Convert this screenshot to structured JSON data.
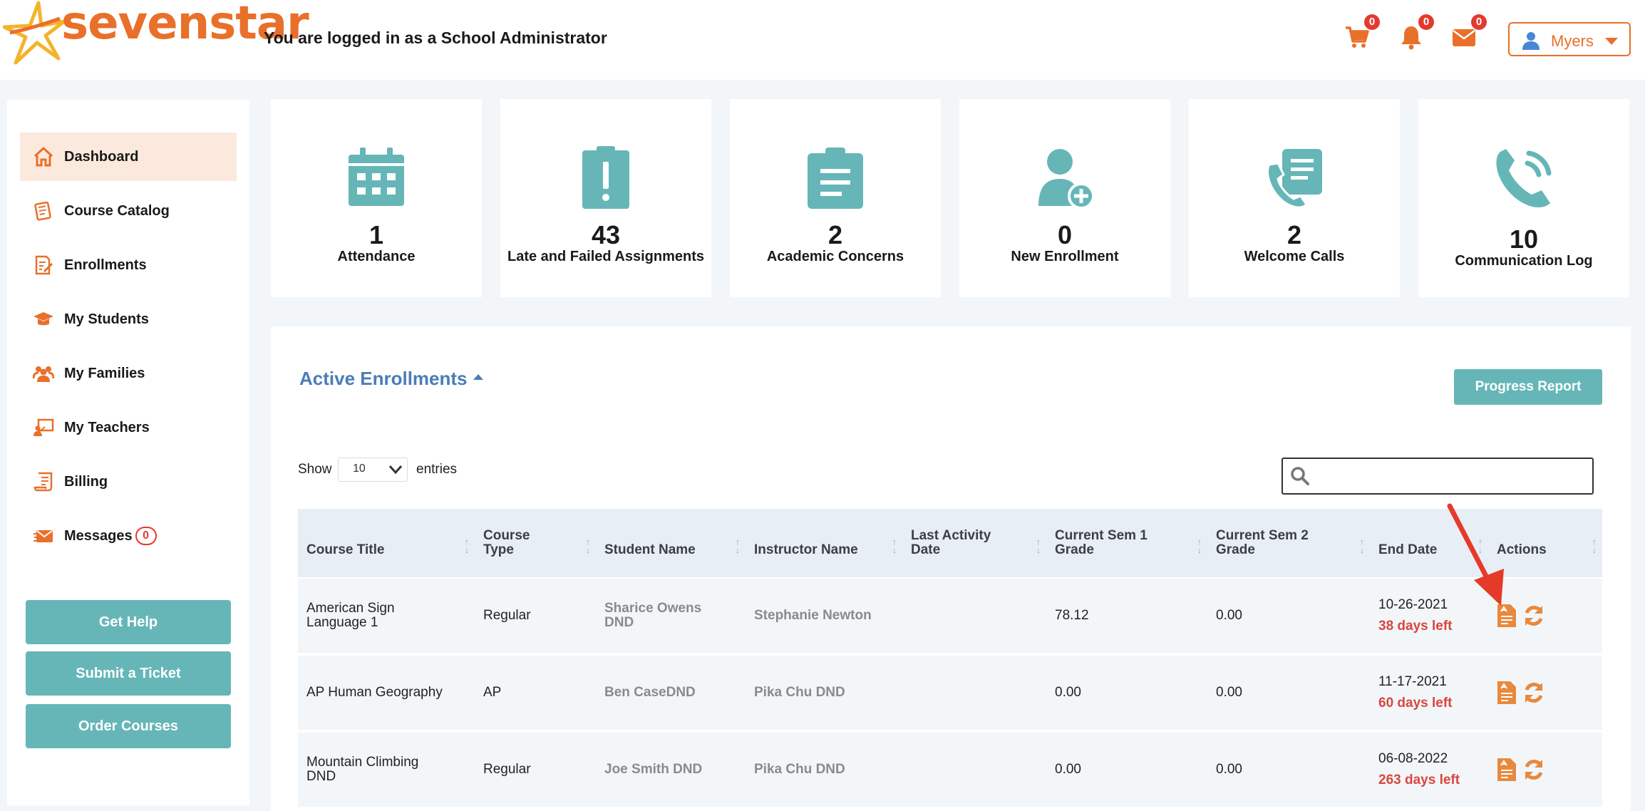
{
  "header": {
    "logo_text": "sevenstar",
    "logged_in_text": "You are logged in as a School Administrator",
    "icons": [
      {
        "name": "cart-icon",
        "count": "0"
      },
      {
        "name": "bell-icon",
        "count": "0"
      },
      {
        "name": "mail-icon",
        "count": "0"
      }
    ],
    "user_name": "Myers",
    "accent_color": "#e8702a"
  },
  "sidebar": {
    "items": [
      {
        "label": "Dashboard",
        "icon": "home-icon",
        "active": true
      },
      {
        "label": "Course Catalog",
        "icon": "book-icon"
      },
      {
        "label": "Enrollments",
        "icon": "edit-document-icon"
      },
      {
        "label": "My Students",
        "icon": "graduation-cap-icon"
      },
      {
        "label": "My Families",
        "icon": "users-icon"
      },
      {
        "label": "My Teachers",
        "icon": "teacher-icon"
      },
      {
        "label": "Billing",
        "icon": "receipt-icon"
      },
      {
        "label": "Messages",
        "icon": "envelope-icon",
        "count": "0"
      }
    ],
    "buttons": [
      "Get Help",
      "Submit a Ticket",
      "Order Courses"
    ]
  },
  "cards": [
    {
      "value": "1",
      "label": "Attendance",
      "icon": "calendar-icon"
    },
    {
      "value": "43",
      "label": "Late and Failed Assignments",
      "icon": "clipboard-alert-icon"
    },
    {
      "value": "2",
      "label": "Academic Concerns",
      "icon": "clipboard-list-icon"
    },
    {
      "value": "0",
      "label": "New Enrollment",
      "icon": "user-plus-icon"
    },
    {
      "value": "2",
      "label": "Welcome Calls",
      "icon": "phone-list-icon"
    },
    {
      "value": "10",
      "label": "Communication Log",
      "icon": "phone-ring-icon"
    }
  ],
  "enrollments": {
    "title": "Active Enrollments",
    "progress_button": "Progress Report",
    "show_label": "Show",
    "entries_value": "10",
    "entries_label": "entries",
    "search_value": "",
    "columns": [
      {
        "l1": "Course Title",
        "l2": ""
      },
      {
        "l1": "Course",
        "l2": "Type"
      },
      {
        "l1": "Student Name",
        "l2": ""
      },
      {
        "l1": "Instructor Name",
        "l2": ""
      },
      {
        "l1": "Last Activity",
        "l2": "Date"
      },
      {
        "l1": "Current Sem 1",
        "l2": "Grade"
      },
      {
        "l1": "Current Sem 2",
        "l2": "Grade"
      },
      {
        "l1": "End Date",
        "l2": ""
      },
      {
        "l1": "Actions",
        "l2": ""
      }
    ],
    "rows": [
      {
        "course_l1": "American Sign",
        "course_l2": "Language 1",
        "type": "Regular",
        "student_l1": "Sharice Owens",
        "student_l2": "DND",
        "instructor": "Stephanie Newton",
        "last_activity": "",
        "sem1": "78.12",
        "sem2": "0.00",
        "end_date": "10-26-2021",
        "days_left": "38 days left"
      },
      {
        "course_l1": "AP Human Geography",
        "course_l2": "",
        "type": "AP",
        "student_l1": "Ben CaseDND",
        "student_l2": "",
        "instructor": "Pika Chu DND",
        "last_activity": "",
        "sem1": "0.00",
        "sem2": "0.00",
        "end_date": "11-17-2021",
        "days_left": "60 days left"
      },
      {
        "course_l1": "Mountain Climbing",
        "course_l2": "DND",
        "type": "Regular",
        "student_l1": "Joe Smith DND",
        "student_l2": "",
        "instructor": "Pika Chu DND",
        "last_activity": "",
        "sem1": "0.00",
        "sem2": "0.00",
        "end_date": "06-08-2022",
        "days_left": "263 days left"
      }
    ],
    "action_icons": [
      "report-card-icon",
      "refresh-icon"
    ]
  },
  "colors": {
    "teal": "#66b6b8",
    "orange": "#e8702a",
    "red": "#d9463d",
    "blue_link": "#4a7db5"
  }
}
